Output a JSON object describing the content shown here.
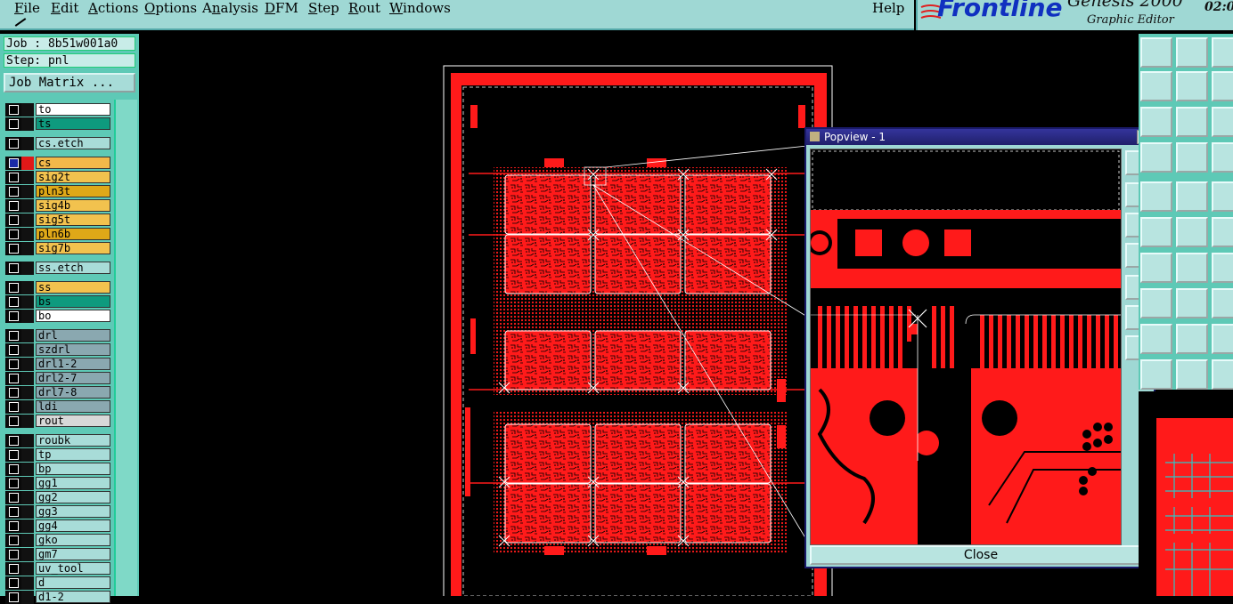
{
  "menu": {
    "items": [
      {
        "label": "File",
        "key": "F"
      },
      {
        "label": "Edit",
        "key": "E"
      },
      {
        "label": "Actions",
        "key": "A"
      },
      {
        "label": "Options",
        "key": "O"
      },
      {
        "label": "Analysis",
        "key": "n"
      },
      {
        "label": "DFM",
        "key": "D"
      },
      {
        "label": "Step",
        "key": "S"
      },
      {
        "label": "Rout",
        "key": "R"
      },
      {
        "label": "Windows",
        "key": "W"
      }
    ],
    "help": "Help"
  },
  "brand": {
    "logo": "Frontline",
    "product": "Genesis 2000",
    "subtitle": "Graphic Editor",
    "clock": "02:0"
  },
  "job": {
    "job_line": "Job : 8b51w001a0",
    "step_line": "Step: pnl",
    "matrix_button": "Job Matrix ..."
  },
  "layers": [
    {
      "name": "to",
      "color": "#ffffff",
      "group": 0
    },
    {
      "name": "ts",
      "color": "#0e9a7e",
      "group": 0
    },
    {
      "name": "cs.etch",
      "color": "#a8dcd8",
      "group": 1
    },
    {
      "name": "cs",
      "color": "#f2b84a",
      "group": 2,
      "active": true
    },
    {
      "name": "sig2t",
      "color": "#f2c24e",
      "group": 2
    },
    {
      "name": "pln3t",
      "color": "#dfa818",
      "group": 2
    },
    {
      "name": "sig4b",
      "color": "#f2c24e",
      "group": 2
    },
    {
      "name": "sig5t",
      "color": "#f2c24e",
      "group": 2
    },
    {
      "name": "pln6b",
      "color": "#dfa818",
      "group": 2
    },
    {
      "name": "sig7b",
      "color": "#f2c24e",
      "group": 2
    },
    {
      "name": "ss.etch",
      "color": "#a8dcd8",
      "group": 3
    },
    {
      "name": "ss",
      "color": "#f2c24e",
      "group": 4
    },
    {
      "name": "bs",
      "color": "#0e9a7e",
      "group": 4
    },
    {
      "name": "bo",
      "color": "#ffffff",
      "group": 4
    },
    {
      "name": "drl",
      "color": "#8aa8b0",
      "group": 5
    },
    {
      "name": "szdrl",
      "color": "#8aa8b0",
      "group": 5
    },
    {
      "name": "drl1-2",
      "color": "#8aa8b0",
      "group": 5
    },
    {
      "name": "drl2-7",
      "color": "#8aa8b0",
      "group": 5
    },
    {
      "name": "drl7-8",
      "color": "#8aa8b0",
      "group": 5
    },
    {
      "name": "ldi",
      "color": "#8aa8b0",
      "group": 5
    },
    {
      "name": "rout",
      "color": "#d8d8d8",
      "group": 5
    },
    {
      "name": "roubk",
      "color": "#a8dcd8",
      "group": 6
    },
    {
      "name": "tp",
      "color": "#a8dcd8",
      "group": 6
    },
    {
      "name": "bp",
      "color": "#a8dcd8",
      "group": 6
    },
    {
      "name": "gg1",
      "color": "#a8dcd8",
      "group": 6
    },
    {
      "name": "gg2",
      "color": "#a8dcd8",
      "group": 6
    },
    {
      "name": "gg3",
      "color": "#a8dcd8",
      "group": 6
    },
    {
      "name": "gg4",
      "color": "#a8dcd8",
      "group": 6
    },
    {
      "name": "gko",
      "color": "#a8dcd8",
      "group": 6
    },
    {
      "name": "gm7",
      "color": "#a8dcd8",
      "group": 6
    },
    {
      "name": "uv_tool",
      "color": "#a8dcd8",
      "group": 6
    },
    {
      "name": "d",
      "color": "#a8dcd8",
      "group": 6
    },
    {
      "name": "d1-2",
      "color": "#a8dcd8",
      "group": 6
    }
  ],
  "popview": {
    "title": "Popview - 1",
    "close_label": "Close"
  },
  "colors": {
    "copper": "#ff1a1a",
    "panel_bg": "#9fd8d4",
    "layer_bg": "#5ec9b6",
    "title_bar": "#20206a"
  },
  "icons": {
    "popview_tools": [
      "zoom-home-icon",
      "zoom-in-icon",
      "zoom-out-icon",
      "pan-left-icon",
      "pan-right-icon",
      "zoom-fit-icon",
      "zoom-area-icon"
    ],
    "right_tools": [
      "zoom-in-icon",
      "zoom-out-icon",
      "pan-icon",
      "snap-icon",
      "measure-icon",
      "select-icon"
    ]
  }
}
